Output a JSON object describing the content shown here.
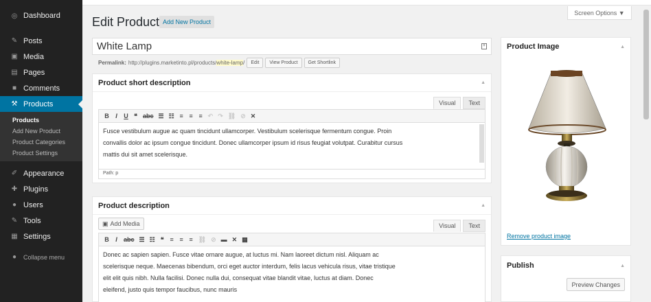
{
  "sidebar": {
    "items": [
      {
        "label": "Dashboard",
        "icon": "dashboard-icon",
        "glyph": "◎"
      },
      {
        "label": "Posts",
        "icon": "pin-icon",
        "glyph": "✎"
      },
      {
        "label": "Media",
        "icon": "media-icon",
        "glyph": "▣"
      },
      {
        "label": "Pages",
        "icon": "pages-icon",
        "glyph": "▤"
      },
      {
        "label": "Comments",
        "icon": "comments-icon",
        "glyph": "■"
      },
      {
        "label": "Products",
        "icon": "products-icon",
        "glyph": "⚒"
      }
    ],
    "submenu": [
      "Products",
      "Add New Product",
      "Product Categories",
      "Product Settings"
    ],
    "items2": [
      {
        "label": "Appearance",
        "icon": "appearance-icon",
        "glyph": "✐"
      },
      {
        "label": "Plugins",
        "icon": "plugins-icon",
        "glyph": "✚"
      },
      {
        "label": "Users",
        "icon": "users-icon",
        "glyph": "●"
      },
      {
        "label": "Tools",
        "icon": "tools-icon",
        "glyph": "✎"
      },
      {
        "label": "Settings",
        "icon": "settings-icon",
        "glyph": "▦"
      }
    ],
    "collapse": "Collapse menu"
  },
  "header": {
    "screen_options": "Screen Options ▼",
    "title": "Edit Product",
    "add_new": "Add New Product"
  },
  "product": {
    "title": "White Lamp",
    "permalink_label": "Permalink:",
    "permalink_base": "http://plugins.marketinto.pl/products/",
    "permalink_slug": "white-lamp",
    "permalink_end": "/",
    "edit": "Edit",
    "view": "View Product",
    "shortlink": "Get Shortlink"
  },
  "short_desc": {
    "heading": "Product short description",
    "tab_visual": "Visual",
    "tab_text": "Text",
    "text": "Fusce vestibulum augue ac quam tincidunt ullamcorper. Vestibulum scelerisque fermentum congue. Proin convallis dolor ac ipsum congue tincidunt. Donec ullamcorper ipsum id risus feugiat volutpat. Curabitur cursus mattis dui sit amet scelerisque.",
    "path": "Path: p"
  },
  "desc": {
    "heading": "Product description",
    "add_media": "Add Media",
    "tab_visual": "Visual",
    "tab_text": "Text",
    "text": "Donec ac sapien sapien. Fusce vitae ornare augue, at luctus mi. Nam laoreet dictum nisl. Aliquam ac scelerisque neque. Maecenas bibendum, orci eget auctor interdum, felis lacus vehicula risus, vitae tristique elit elit quis nibh. Nulla facilisi. Donec nulla dui, consequat vitae blandit vitae, luctus at diam. Donec eleifend, justo quis tempor faucibus, nunc mauris"
  },
  "image_box": {
    "heading": "Product Image",
    "remove": "Remove product image"
  },
  "publish": {
    "heading": "Publish",
    "preview": "Preview Changes"
  },
  "colors": {
    "accent": "#0074a2",
    "sidebar": "#222222"
  }
}
